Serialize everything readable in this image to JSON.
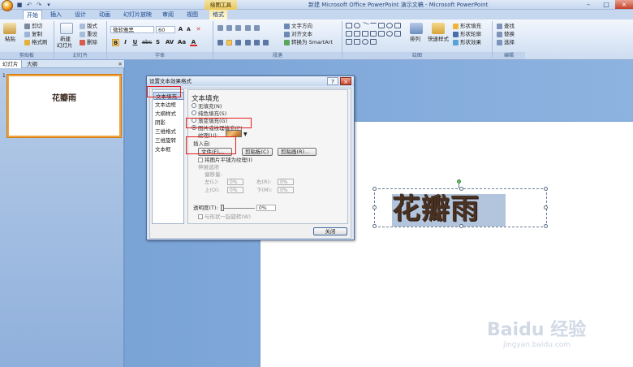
{
  "window": {
    "title": "新建 Microsoft Office PowerPoint 演示文稿 - Microsoft PowerPoint",
    "contextual_tool_title": "绘图工具",
    "controls": {
      "minimize": "–",
      "maximize": "□",
      "close": "×"
    }
  },
  "quick_access": [
    "save-icon",
    "undo-icon",
    "redo-icon",
    "customize-icon"
  ],
  "tabs": [
    {
      "label": "开始",
      "active": true
    },
    {
      "label": "插入"
    },
    {
      "label": "设计"
    },
    {
      "label": "动画"
    },
    {
      "label": "幻灯片放映"
    },
    {
      "label": "审阅"
    },
    {
      "label": "视图"
    },
    {
      "label": "格式",
      "contextual": true
    }
  ],
  "ribbon": {
    "clipboard": {
      "label": "剪贴板",
      "paste": "粘贴",
      "cut": "剪切",
      "copy": "复制",
      "format_painter": "格式刷"
    },
    "slides": {
      "label": "幻灯片",
      "new_slide": "新建",
      "new_slide_2": "幻灯片",
      "layout": "版式",
      "reset": "重设",
      "delete": "删除"
    },
    "font": {
      "label": "字体",
      "font_name": "微软雅黑",
      "font_size": "60",
      "grow": "A",
      "shrink": "A",
      "bold": "B",
      "italic": "I",
      "underline": "U",
      "strike": "abc",
      "shadow": "S",
      "spacing": "AV",
      "case": "Aa",
      "color": "A"
    },
    "paragraph": {
      "label": "段落",
      "text_direction": "文字方向",
      "align_text": "对齐文本",
      "smartart": "转换为 SmartArt"
    },
    "drawing": {
      "label": "绘图",
      "arrange": "排列",
      "quick_styles": "快速样式",
      "shape_fill": "形状填充",
      "shape_outline": "形状轮廓",
      "shape_effects": "形状效果"
    },
    "editing": {
      "label": "编辑",
      "find": "查找",
      "replace": "替换",
      "select": "选择"
    }
  },
  "slide_pane": {
    "tabs": [
      "幻灯片",
      "大纲"
    ],
    "close": "×",
    "thumbnails": [
      {
        "number": "1",
        "title": "花瓣雨"
      }
    ]
  },
  "slide": {
    "text": "花瓣雨"
  },
  "dialog": {
    "title": "设置文本效果格式",
    "help": "?",
    "close": "×",
    "nav_items": [
      "文本填充",
      "文本边框",
      "大纲样式",
      "阴影",
      "三维格式",
      "三维旋转",
      "文本框"
    ],
    "selected_nav": 0,
    "section_heading": "文本填充",
    "fill_options": [
      {
        "label": "无填充(N)",
        "selected": false
      },
      {
        "label": "纯色填充(S)",
        "selected": false
      },
      {
        "label": "渐变填充(G)",
        "selected": false
      },
      {
        "label": "图片或纹理填充(P)",
        "selected": true
      }
    ],
    "texture_label": "纹理(U):",
    "insert_from_label": "插入自:",
    "file_button": "文件(F)...",
    "clipboard_button": "剪贴板(C)",
    "clipart_button": "剪贴画(R)...",
    "tile_checkbox": "将图片平铺为纹理(I)",
    "stretch_options_label": "伸展选项",
    "offsets_label": "偏移量:",
    "offsets": [
      {
        "label": "左(L):",
        "value": "0%"
      },
      {
        "label": "右(R):",
        "value": "0%"
      },
      {
        "label": "上(O):",
        "value": "0%"
      },
      {
        "label": "下(M):",
        "value": "0%"
      }
    ],
    "transparency_label": "透明度(T):",
    "transparency_value": "0%",
    "transparency_fraction": 0,
    "rotate_checkbox": "与形状一起旋转(W)",
    "close_button": "关闭"
  },
  "watermark": {
    "brand": "Baidu 经验",
    "url": "jingyan.baidu.com"
  },
  "colors": {
    "annotation_red": "#e81c1c",
    "orange_accent": "#f2a23a",
    "ribbon_blue": "#dbe7f6"
  }
}
